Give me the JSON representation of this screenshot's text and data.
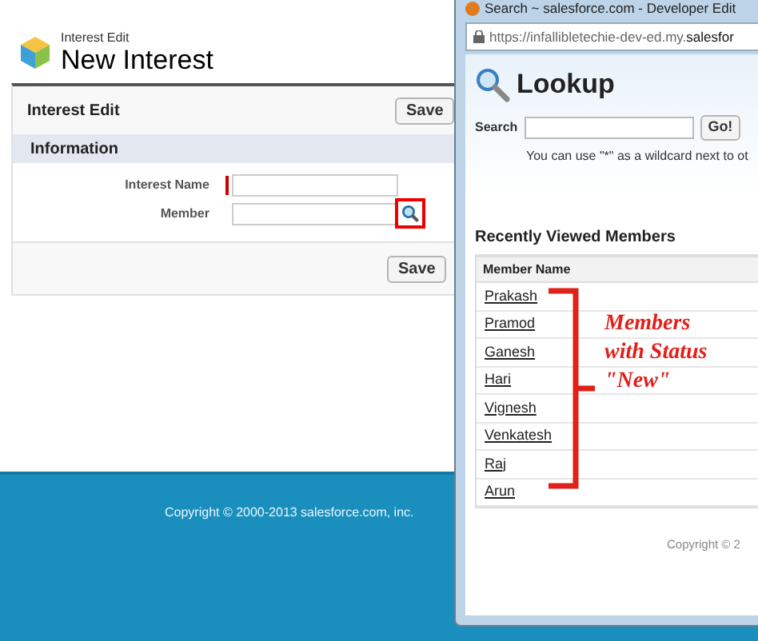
{
  "page": {
    "breadcrumb": "Interest Edit",
    "title": "New Interest"
  },
  "panel": {
    "title": "Interest Edit",
    "buttons": [
      "Save"
    ],
    "section": "Information",
    "fields": [
      {
        "label": "Interest Name",
        "required": true,
        "lookup": false
      },
      {
        "label": "Member",
        "required": false,
        "lookup": true
      }
    ],
    "bottom_buttons": [
      "Save"
    ]
  },
  "footer": {
    "copyright": "Copyright © 2000-2013 salesforce.com, inc."
  },
  "popup": {
    "window_title": "Search ~ salesforce.com - Developer Edit",
    "url_host": "https://infallibletechie-dev-ed.my.",
    "url_domain": "salesfor",
    "title": "Lookup",
    "search_label": "Search",
    "go": "Go!",
    "hint": "You can use \"*\" as a wildcard next to ot",
    "section": "Recently Viewed Members",
    "column": "Member Name",
    "rows": [
      "Prakash",
      "Pramod",
      "Ganesh",
      "Hari",
      "Vignesh",
      "Venkatesh",
      "Raj",
      "Arun"
    ],
    "copyright": "Copyright © 2"
  },
  "annotation": {
    "lines": [
      "Members",
      "with Status",
      "\"New\""
    ]
  }
}
